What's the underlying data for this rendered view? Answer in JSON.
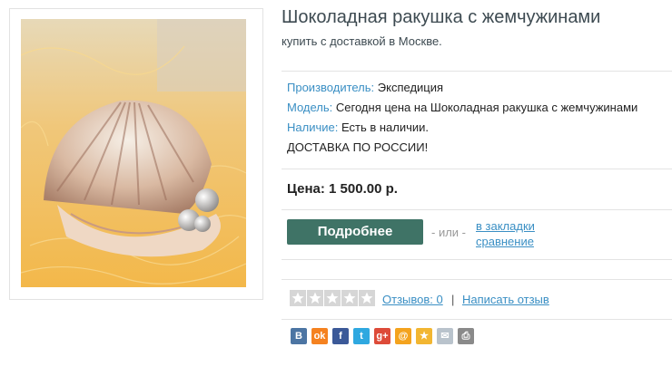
{
  "product": {
    "title": "Шоколадная ракушка с жемчужинами",
    "subtitle": "купить с доставкой в Москве.",
    "image_alt": "shell-with-pearls-photo"
  },
  "info": {
    "manufacturer_label": "Производитель:",
    "manufacturer_value": "Экспедиция",
    "model_label": "Модель:",
    "model_value": "Сегодня цена на Шоколадная ракушка с жемчужинами",
    "availability_label": "Наличие:",
    "availability_value": "Есть в наличии.",
    "delivery": "ДОСТАВКА ПО РОССИИ!"
  },
  "price": "Цена: 1 500.00 р.",
  "actions": {
    "more_button": "Подробнее",
    "or_text": "- или -",
    "bookmarks_link": "в закладки",
    "compare_link": "сравнение"
  },
  "reviews": {
    "rating": 0,
    "max_rating": 5,
    "reviews_link": "Отзывов: 0",
    "separator": "|",
    "write_review_link": "Написать отзыв"
  },
  "share": [
    {
      "name": "vkontakte-icon",
      "glyph": "B",
      "color": "#4c75a3"
    },
    {
      "name": "odnoklassniki-icon",
      "glyph": "ok",
      "color": "#f58220"
    },
    {
      "name": "facebook-icon",
      "glyph": "f",
      "color": "#3b5998"
    },
    {
      "name": "twitter-icon",
      "glyph": "t",
      "color": "#2fa8e0"
    },
    {
      "name": "google-plus-icon",
      "glyph": "g+",
      "color": "#dd4b39"
    },
    {
      "name": "mail-ru-icon",
      "glyph": "@",
      "color": "#f4a31e"
    },
    {
      "name": "favorites-star-icon",
      "glyph": "★",
      "color": "#f2b632"
    },
    {
      "name": "email-icon",
      "glyph": "✉",
      "color": "#b9c3cc"
    },
    {
      "name": "print-icon",
      "glyph": "⎙",
      "color": "#8a8a8a"
    }
  ]
}
